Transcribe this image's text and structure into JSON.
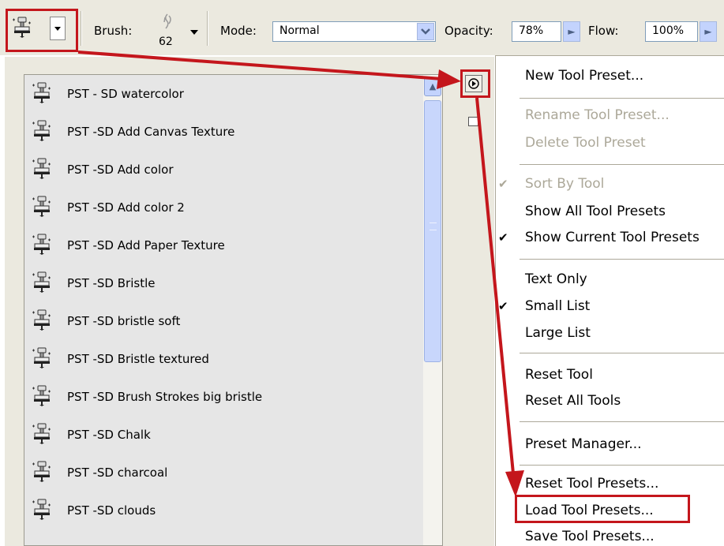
{
  "toolbar": {
    "brush_label": "Brush:",
    "brush_size": "62",
    "mode_label": "Mode:",
    "mode_value": "Normal",
    "opacity_label": "Opacity:",
    "opacity_value": "78%",
    "flow_label": "Flow:",
    "flow_value": "100%"
  },
  "presets": [
    {
      "label": "PST - SD watercolor"
    },
    {
      "label": "PST -SD Add Canvas Texture"
    },
    {
      "label": "PST -SD Add color"
    },
    {
      "label": "PST -SD Add color 2"
    },
    {
      "label": "PST -SD Add Paper Texture"
    },
    {
      "label": "PST -SD Bristle"
    },
    {
      "label": "PST -SD bristle soft"
    },
    {
      "label": "PST -SD Bristle textured"
    },
    {
      "label": "PST -SD Brush Strokes big bristle"
    },
    {
      "label": "PST -SD Chalk"
    },
    {
      "label": "PST -SD charcoal"
    },
    {
      "label": "PST -SD clouds"
    }
  ],
  "menu": {
    "new_preset": "New Tool Preset...",
    "rename_preset": "Rename Tool Preset...",
    "delete_preset": "Delete Tool Preset",
    "sort_by_tool": "Sort By Tool",
    "show_all": "Show All Tool Presets",
    "show_current": "Show Current Tool Presets",
    "text_only": "Text Only",
    "small_list": "Small List",
    "large_list": "Large List",
    "reset_tool": "Reset Tool",
    "reset_all_tools": "Reset All Tools",
    "preset_manager": "Preset Manager...",
    "reset_presets": "Reset Tool Presets...",
    "load_presets": "Load Tool Presets...",
    "save_presets": "Save Tool Presets..."
  },
  "colors": {
    "annotation": "#c4161c",
    "panel_bg": "#ebe9df",
    "list_bg": "#e6e6e6"
  }
}
